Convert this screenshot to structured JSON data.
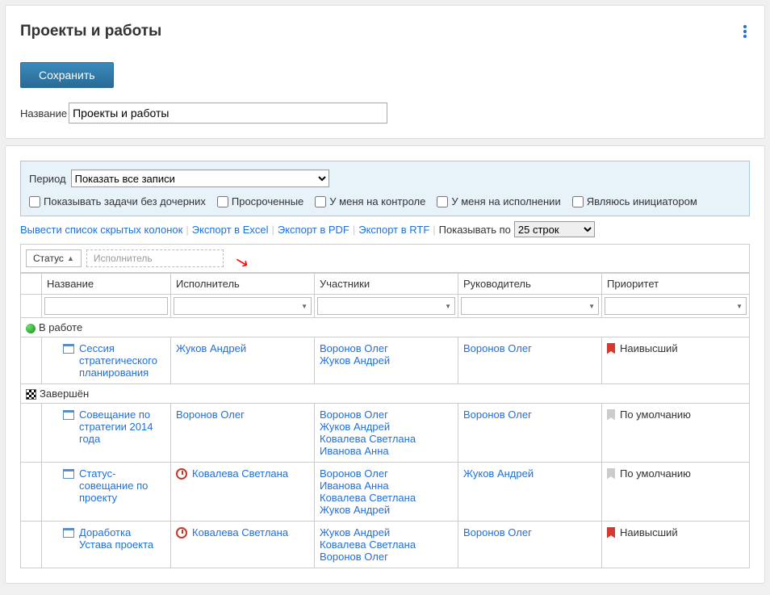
{
  "header": {
    "title": "Проекты и работы"
  },
  "actions": {
    "save": "Сохранить"
  },
  "name_field": {
    "label": "Название",
    "value": "Проекты и работы"
  },
  "filters": {
    "period_label": "Период",
    "period_value": "Показать все записи",
    "checks": {
      "no_children": "Показывать задачи без дочерних",
      "overdue": "Просроченные",
      "my_control": "У меня на контроле",
      "my_exec": "У меня на исполнении",
      "initiator": "Являюсь инициатором"
    }
  },
  "toolbar": {
    "hidden_cols": "Вывести список скрытых колонок",
    "export_excel": "Экспорт в Excel",
    "export_pdf": "Экспорт в PDF",
    "export_rtf": "Экспорт в RTF",
    "show_by": "Показывать по",
    "page_size": "25 строк"
  },
  "grouping": {
    "status": "Статус",
    "placeholder": "Исполнитель"
  },
  "columns": {
    "name": "Название",
    "executor": "Исполнитель",
    "participants": "Участники",
    "lead": "Руководитель",
    "priority": "Приоритет"
  },
  "groups": {
    "in_work": "В работе",
    "done": "Завершён"
  },
  "rows": [
    {
      "group": "in_work",
      "name": "Сессия стратегического планирования",
      "executor": "Жуков Андрей",
      "participants": [
        "Воронов Олег",
        "Жуков Андрей"
      ],
      "lead": "Воронов Олег",
      "priority": "Наивысший",
      "priority_kind": "high",
      "overdue": false
    },
    {
      "group": "done",
      "name": "Совещание по стратегии 2014 года",
      "executor": "Воронов Олег",
      "participants": [
        "Воронов Олег",
        "Жуков Андрей",
        "Ковалева Светлана",
        "Иванова Анна"
      ],
      "lead": "Воронов Олег",
      "priority": "По умолчанию",
      "priority_kind": "default",
      "overdue": false
    },
    {
      "group": "done",
      "name": "Статус-совещание по проекту",
      "executor": "Ковалева Светлана",
      "participants": [
        "Воронов Олег",
        "Иванова Анна",
        "Ковалева Светлана",
        "Жуков Андрей"
      ],
      "lead": "Жуков Андрей",
      "priority": "По умолчанию",
      "priority_kind": "default",
      "overdue": true
    },
    {
      "group": "done",
      "name": "Доработка Устава проекта",
      "executor": "Ковалева Светлана",
      "participants": [
        "Жуков Андрей",
        "Ковалева Светлана",
        "Воронов Олег"
      ],
      "lead": "Воронов Олег",
      "priority": "Наивысший",
      "priority_kind": "high",
      "overdue": true
    }
  ]
}
